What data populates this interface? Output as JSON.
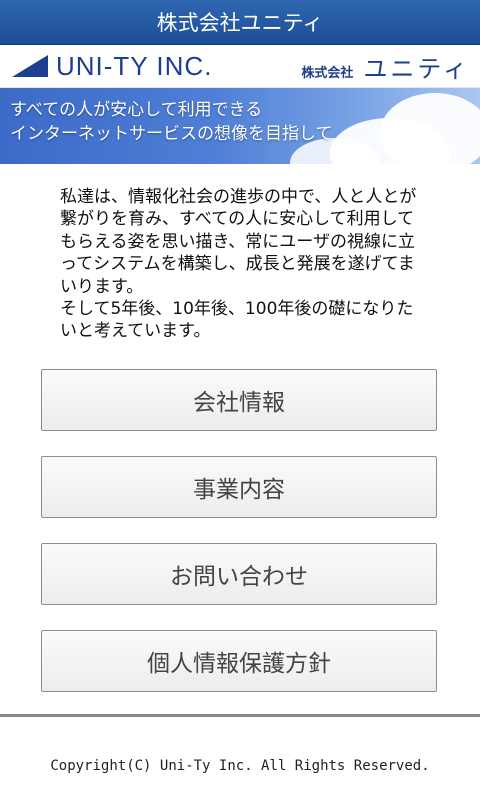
{
  "title_bar": {
    "title": "株式会社ユニティ"
  },
  "brand": {
    "logo_text": "UNI-TY INC.",
    "company_small": "株式会社",
    "company_big": "ユニティ"
  },
  "banner": {
    "line1": "すべての人が安心して利用できる",
    "line2": "インターネットサービスの想像を目指して"
  },
  "intro": {
    "paragraph1": "私達は、情報化社会の進歩の中で、人と人とが繋がりを育み、すべての人に安心して利用してもらえる姿を思い描き、常にユーザの視線に立ってシステムを構築し、成長と発展を遂げてまいります。",
    "paragraph2": "そして5年後、10年後、100年後の礎になりたいと考えています。"
  },
  "menu": [
    {
      "label": "会社情報"
    },
    {
      "label": "事業内容"
    },
    {
      "label": "お問い合わせ"
    },
    {
      "label": "個人情報保護方針"
    }
  ],
  "footer": {
    "copyright": "Copyright(C) Uni-Ty Inc. All Rights Reserved."
  },
  "colors": {
    "title_bar": "#2f67b0",
    "brand_text": "#1e3f8f",
    "banner": "#4f7fd6"
  }
}
